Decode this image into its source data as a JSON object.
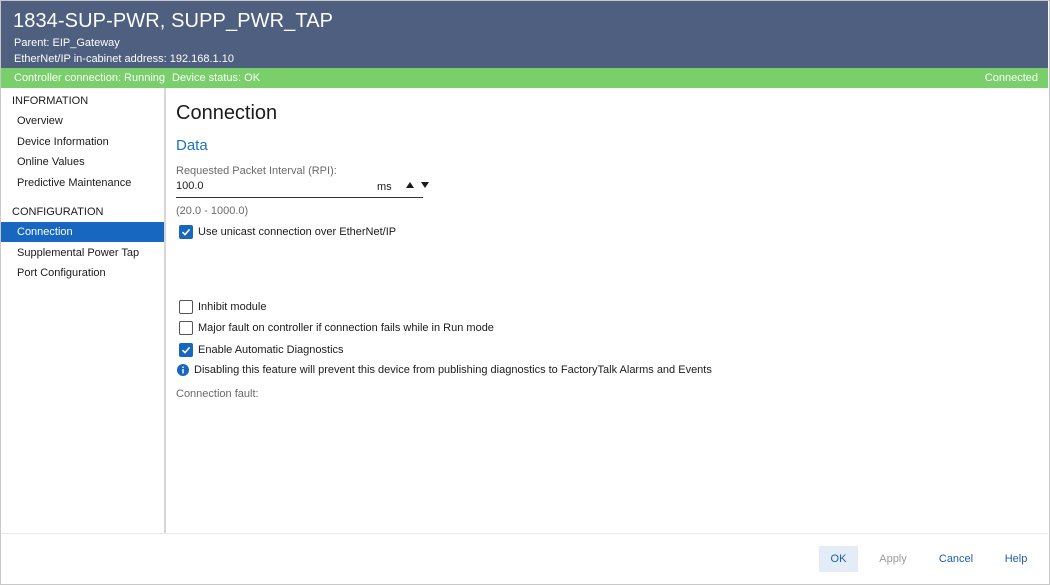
{
  "header": {
    "title": "1834-SUP-PWR, SUPP_PWR_TAP",
    "parent": "Parent:  EIP_Gateway",
    "address": "EtherNet/IP in-cabinet address:  192.168.1.10"
  },
  "status": {
    "controller": "Controller connection: Running",
    "device": "Device status: OK",
    "connected": "Connected"
  },
  "sidebar": {
    "information_header": "INFORMATION",
    "information_items": [
      "Overview",
      "Device Information",
      "Online Values",
      "Predictive Maintenance"
    ],
    "configuration_header": "CONFIGURATION",
    "configuration_items": [
      "Connection",
      "Supplemental Power Tap",
      "Port Configuration"
    ],
    "active_item": "Connection"
  },
  "main": {
    "title": "Connection",
    "section": "Data",
    "rpi": {
      "label": "Requested Packet Interval (RPI):",
      "value": "100.0",
      "unit": "ms",
      "range": "(20.0 - 1000.0)"
    },
    "unicast": {
      "label": "Use unicast connection over EtherNet/IP",
      "checked": true
    },
    "inhibit": {
      "label": "Inhibit module",
      "checked": false
    },
    "major_fault": {
      "label": "Major fault on controller if connection fails while in Run mode",
      "checked": false
    },
    "auto_diag": {
      "label": "Enable Automatic Diagnostics",
      "checked": true
    },
    "info_text": "Disabling this feature will prevent this device from publishing diagnostics to FactoryTalk Alarms and Events",
    "connection_fault_label": "Connection fault:"
  },
  "footer": {
    "ok": "OK",
    "apply": "Apply",
    "cancel": "Cancel",
    "help": "Help"
  },
  "colors": {
    "header_bg": "#4e5f7f",
    "status_bg": "#79cf6a",
    "accent": "#1767c0",
    "section_title": "#1f72c4"
  },
  "icons": {
    "checkbox_checked": "check-icon",
    "info": "info-icon",
    "spinner_up": "triangle-up-icon",
    "spinner_down": "triangle-down-icon"
  }
}
